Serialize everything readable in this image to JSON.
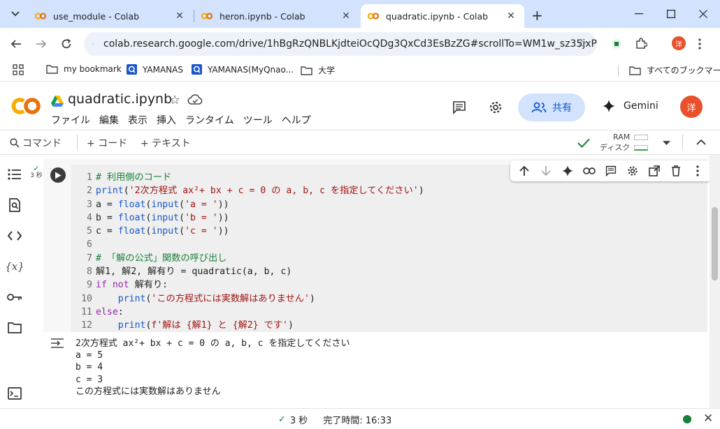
{
  "browser": {
    "tabs": [
      {
        "label": "use_module - Colab",
        "close": "✕",
        "active": false
      },
      {
        "label": "heron.ipynb - Colab",
        "close": "✕",
        "active": false
      },
      {
        "label": "quadratic.ipynb - Colab",
        "close": "✕",
        "active": true
      }
    ],
    "new_tab": "+",
    "url": "colab.research.google.com/drive/1hBgRzQNBLKjdteiOcQDg3QxCd3EsBzZG#scrollTo=WM1w_sz35jxP",
    "profile_initial": "洋",
    "bookmarks": [
      {
        "label": "my bookmark",
        "icon": "folder-icon"
      },
      {
        "label": "YAMANAS",
        "icon": "q-icon"
      },
      {
        "label": "YAMANAS(MyQnao...",
        "icon": "q-icon"
      },
      {
        "label": "大学",
        "icon": "folder-icon"
      }
    ],
    "all_bookmarks": "すべてのブックマーク"
  },
  "colab": {
    "notebook_title": "quadratic.ipynb",
    "menu": [
      "ファイル",
      "編集",
      "表示",
      "挿入",
      "ランタイム",
      "ツール",
      "ヘルプ"
    ],
    "share_label": "共有",
    "gemini_label": "Gemini",
    "avatar_initial": "洋",
    "toolbar": {
      "command": "コマンド",
      "add_code": "+ コード",
      "add_text": "+ テキスト",
      "ram": "RAM",
      "disk": "ディスク"
    },
    "exec_status": {
      "check": "✓",
      "time": "3 秒"
    },
    "code_lines": [
      {
        "n": "1",
        "src": "# 利用側のコード"
      },
      {
        "n": "2",
        "src": "print('2次方程式 ax²+ bx + c = 0 の a, b, c を指定してください')"
      },
      {
        "n": "3",
        "src": "a = float(input('a = '))"
      },
      {
        "n": "4",
        "src": "b = float(input('b = '))"
      },
      {
        "n": "5",
        "src": "c = float(input('c = '))"
      },
      {
        "n": "6",
        "src": ""
      },
      {
        "n": "7",
        "src": "# 「解の公式」関数の呼び出し"
      },
      {
        "n": "8",
        "src": "解1, 解2, 解有り = quadratic(a, b, c)"
      },
      {
        "n": "9",
        "src": "if not 解有り:"
      },
      {
        "n": "10",
        "src": "    print('この方程式には実数解はありません')"
      },
      {
        "n": "11",
        "src": "else:"
      },
      {
        "n": "12",
        "src": "    print(f'解は {解1} と {解2} です')"
      }
    ],
    "output_lines": [
      "2次方程式 ax²+ bx + c = 0 の a, b, c を指定してください",
      "a = 5",
      "b = 4",
      "c = 3",
      "この方程式には実数解はありません"
    ],
    "status_bar": {
      "check": "✓",
      "duration": "3 秒",
      "completed": "完了時間: 16:33"
    }
  }
}
